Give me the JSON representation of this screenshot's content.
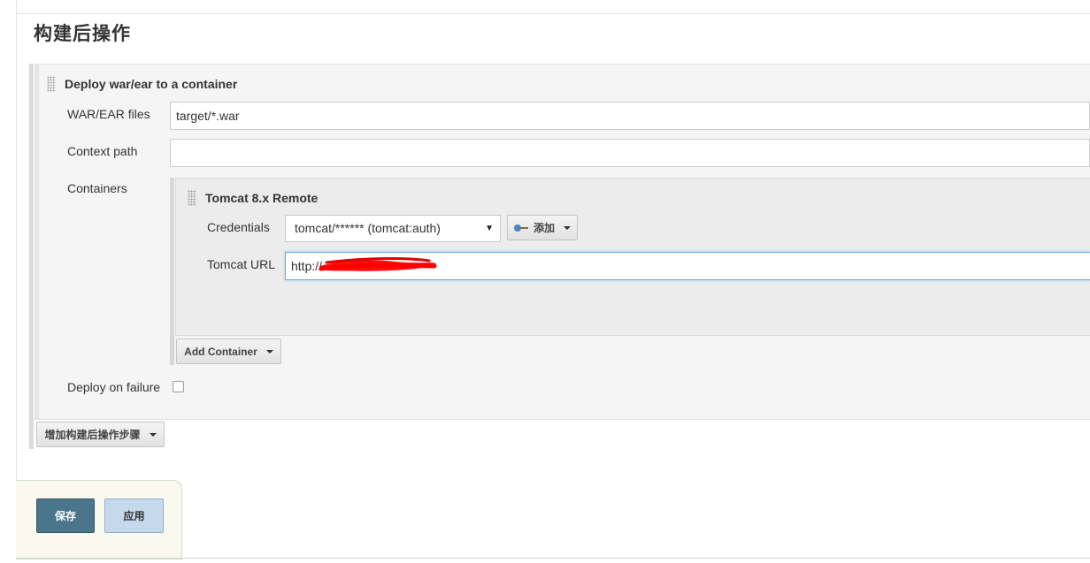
{
  "section": {
    "title": "构建后操作"
  },
  "step": {
    "title": "Deploy war/ear to a container",
    "fields": {
      "war_label": "WAR/EAR files",
      "war_value": "target/*.war",
      "context_label": "Context path",
      "context_value": "",
      "containers_label": "Containers",
      "deploy_failure_label": "Deploy on failure",
      "deploy_failure_checked": false
    },
    "container": {
      "title": "Tomcat 8.x Remote",
      "credentials_label": "Credentials",
      "credentials_selected": "tomcat/****** (tomcat:auth)",
      "add_button_label": "添加",
      "url_label": "Tomcat URL",
      "url_value": "http://"
    },
    "add_container_label": "Add Container"
  },
  "add_step_label": "增加构建后操作步骤",
  "footer": {
    "save_label": "保存",
    "apply_label": "应用"
  },
  "colors": {
    "save_bg": "#4b758b",
    "apply_bg": "#c5d9ed",
    "redaction": "#ff0000"
  },
  "icons": {
    "key": "key-icon",
    "caret": "caret-down-icon",
    "drag_handle": "drag-handle-icon",
    "select_arrow": "select-arrow-icon"
  }
}
